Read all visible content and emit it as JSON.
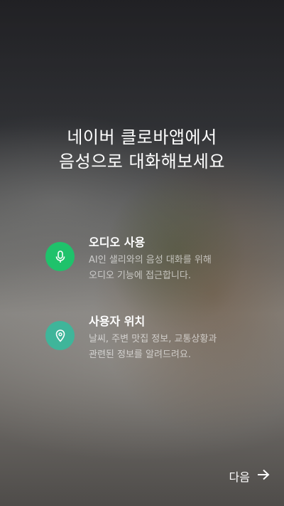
{
  "headline": {
    "line1": "네이버 클로바앱에서",
    "line2": "음성으로 대화해보세요"
  },
  "features": [
    {
      "title": "오디오 사용",
      "desc_line1": "AI인 샐리와의 음성 대화를 위해",
      "desc_line2": "오디오 기능에 접근합니다.",
      "icon": "microphone-icon",
      "color": "#1fc26b"
    },
    {
      "title": "사용자 위치",
      "desc_line1": "날씨, 주변 맛집 정보, 교통상황과",
      "desc_line2": "관련된 정보를 알려드려요.",
      "icon": "location-pin-icon",
      "color": "#3fb59a"
    }
  ],
  "next_button": {
    "label": "다음",
    "icon": "arrow-right-icon"
  }
}
